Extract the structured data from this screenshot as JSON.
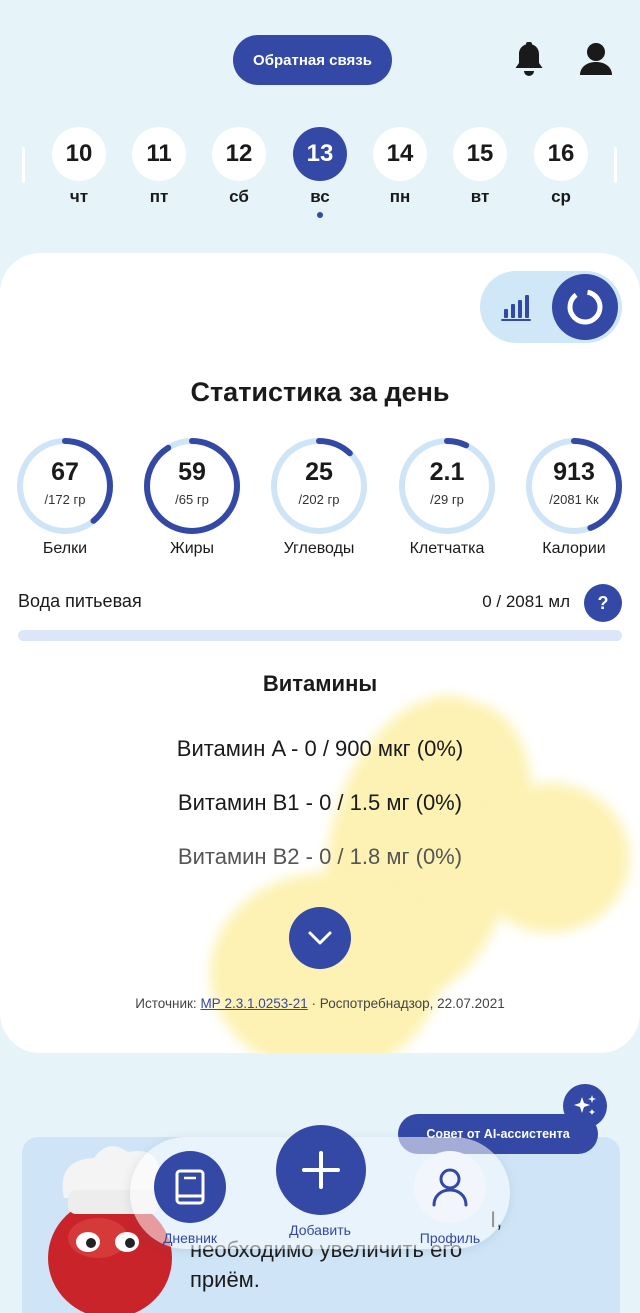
{
  "header": {
    "feedback_label": "Обратная связь"
  },
  "dates": [
    {
      "day": "10",
      "weekday": "чт",
      "active": false
    },
    {
      "day": "11",
      "weekday": "пт",
      "active": false
    },
    {
      "day": "12",
      "weekday": "сб",
      "active": false
    },
    {
      "day": "13",
      "weekday": "вс",
      "active": true
    },
    {
      "day": "14",
      "weekday": "пн",
      "active": false
    },
    {
      "day": "15",
      "weekday": "вт",
      "active": false
    },
    {
      "day": "16",
      "weekday": "ср",
      "active": false
    }
  ],
  "stats": {
    "title": "Статистика за день",
    "rings": [
      {
        "value": "67",
        "goal": "/172 гр",
        "label": "Белки",
        "progress": 0.39
      },
      {
        "value": "59",
        "goal": "/65 гр",
        "label": "Жиры",
        "progress": 0.91
      },
      {
        "value": "25",
        "goal": "/202 гр",
        "label": "Углеводы",
        "progress": 0.12
      },
      {
        "value": "2.1",
        "goal": "/29 гр",
        "label": "Клетчатка",
        "progress": 0.07
      },
      {
        "value": "913",
        "goal": "/2081 Кк",
        "label": "Калории",
        "progress": 0.44
      }
    ]
  },
  "water": {
    "label": "Вода питьевая",
    "value": "0 / 2081 мл",
    "help": "?",
    "progress": 0
  },
  "vitamins": {
    "title": "Витамины",
    "items": [
      "Витамин A - 0 / 900 мкг (0%)",
      "Витамин B1 - 0 / 1.5 мг (0%)",
      "Витамин B2 - 0 / 1.8 мг (0%)"
    ]
  },
  "source": {
    "prefix": "Источник:",
    "link": "МР 2.3.1.0253-21",
    "suffix": "· Роспотребнадзор, 22.07.2021"
  },
  "ai": {
    "badge": "Совет от AI-ассистента",
    "text_line1": "I,",
    "text_line2": "необходимо увеличить его",
    "text_line3": "приём."
  },
  "nav": {
    "diary": "Дневник",
    "add": "Добавить",
    "profile": "Профиль"
  },
  "colors": {
    "primary": "#3349a5",
    "background": "#e6f3f9",
    "ring_track": "#cfe5f7",
    "blob": "#fdf2b3"
  }
}
